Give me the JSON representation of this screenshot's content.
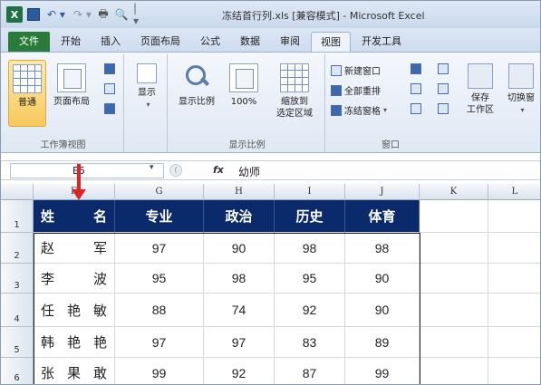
{
  "app": {
    "title": "冻结首行列.xls [兼容模式] - Microsoft Excel",
    "qa_excel_icon": "X",
    "qa_undo": "↶ ▾",
    "qa_redo": "↷ ▾",
    "qa_print": "🖶",
    "qa_preview": "🔍",
    "qa_customize": "|▾"
  },
  "tabs": [
    "文件",
    "开始",
    "插入",
    "页面布局",
    "公式",
    "数据",
    "审阅",
    "视图",
    "开发工具"
  ],
  "ribbon": {
    "workbook_views": {
      "label": "工作簿视图",
      "normal": "普通",
      "page_layout": "页面布局"
    },
    "show": {
      "label": "显示",
      "chev": "▾"
    },
    "zoom": {
      "label": "显示比例",
      "zoom": "显示比例",
      "hundred": "100%",
      "zoom_to_selection_1": "缩放到",
      "zoom_to_selection_2": "选定区域"
    },
    "window": {
      "label": "窗口",
      "new_window": "新建窗口",
      "arrange_all": "全部重排",
      "freeze_panes": "冻结窗格",
      "freeze_chev": "▾",
      "save_workspace_1": "保存",
      "save_workspace_2": "工作区",
      "switch_windows": "切换窗",
      "switch_chev": "▾"
    }
  },
  "formula_bar": {
    "name_box": "E5",
    "name_chev": "▾",
    "fx_left": "(",
    "fx": "fx",
    "value": "幼师"
  },
  "columns": [
    "F",
    "G",
    "H",
    "I",
    "J",
    "K",
    "L"
  ],
  "row_numbers": [
    "1",
    "2",
    "3",
    "4",
    "5",
    "6"
  ],
  "table": {
    "headers": [
      "姓名",
      "专业",
      "政治",
      "历史",
      "体育"
    ],
    "rows": [
      {
        "name": [
          "赵",
          "军"
        ],
        "values": [
          "97",
          "90",
          "98",
          "98"
        ]
      },
      {
        "name": [
          "李",
          "波"
        ],
        "values": [
          "95",
          "98",
          "95",
          "90"
        ]
      },
      {
        "name": [
          "任",
          "艳",
          "敏"
        ],
        "values": [
          "88",
          "74",
          "92",
          "90"
        ]
      },
      {
        "name": [
          "韩",
          "艳",
          "艳"
        ],
        "values": [
          "97",
          "97",
          "83",
          "89"
        ]
      },
      {
        "name": [
          "张",
          "果",
          "敢"
        ],
        "values": [
          "99",
          "92",
          "87",
          "99"
        ]
      }
    ]
  },
  "colors": {
    "header_fill": "#0b2a6b",
    "file_tab": "#2a7a3a",
    "arrow": "#e02323"
  }
}
